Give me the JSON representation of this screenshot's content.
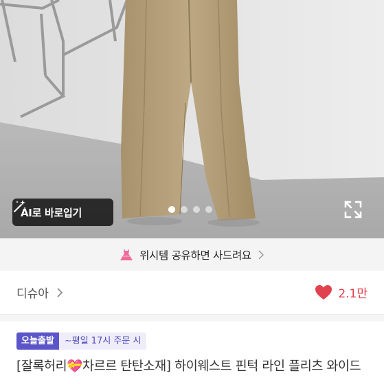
{
  "product_image": {
    "ai_button_label": "AI로 바로입기",
    "carousel": {
      "total": 4,
      "active_index": 0
    }
  },
  "share_bar": {
    "text": "위시템 공유하면 사드려요"
  },
  "seller": {
    "name": "디슈아"
  },
  "likes": {
    "count": "2.1만"
  },
  "shipping": {
    "badge": "오늘출발",
    "info": "~평일 17시 주문 시"
  },
  "product": {
    "title_before_emoji": "[잘록허리",
    "title_emoji": "💝",
    "title_after_emoji": "차르르 탄탄소재] 하이웨스트 핀턱 라인 플리츠 와이드"
  },
  "colors": {
    "like_red": "#e0424f",
    "badge_purple": "#5b55c9",
    "share_bg": "#f4f4f5"
  }
}
